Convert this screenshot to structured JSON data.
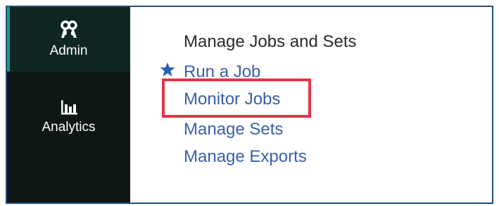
{
  "sidebar": {
    "items": [
      {
        "label": "Admin",
        "icon": "admin-keys-icon",
        "active": true
      },
      {
        "label": "Analytics",
        "icon": "bar-chart-icon",
        "active": false
      }
    ]
  },
  "main": {
    "section_title": "Manage Jobs and Sets",
    "links": [
      {
        "label": "Run a Job",
        "favorite": true
      },
      {
        "label": "Monitor Jobs",
        "highlighted": true
      },
      {
        "label": "Manage Sets"
      },
      {
        "label": "Manage Exports"
      }
    ]
  },
  "colors": {
    "sidebar_bg": "#0e1716",
    "active_item_bg": "#0f2723",
    "active_indicator": "#0fa080",
    "link": "#3a5fa8",
    "highlight": "#e13546",
    "star": "#2c5fb4"
  }
}
